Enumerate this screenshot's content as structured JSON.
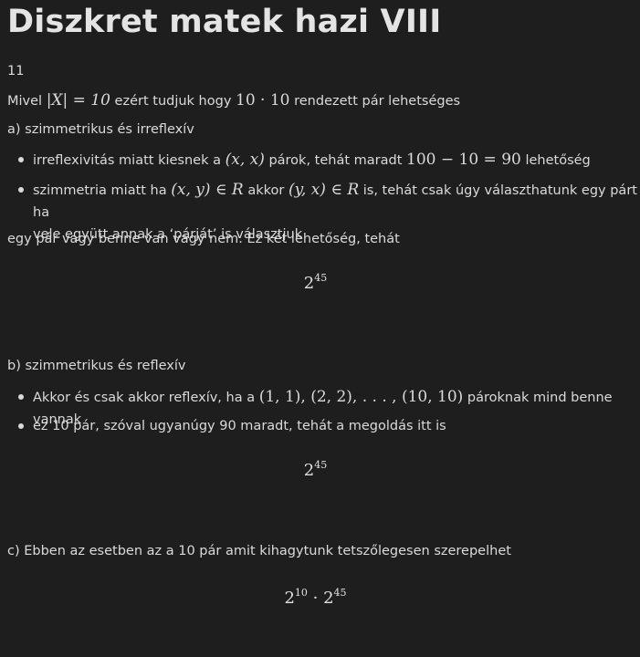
{
  "title": "Diszkret matek hazi VIII",
  "task_number": "11",
  "intro": {
    "pre": "Mivel ",
    "math1": "|X| = 10",
    "mid": " ezért tudjuk hogy ",
    "math2": "10 · 10",
    "post": " rendezett pár lehetséges"
  },
  "part_a": {
    "heading": "a) szimmetrikus és irreflexív",
    "bullet1": {
      "pre": "irreflexivitás miatt kiesnek a ",
      "math1": "(x, x)",
      "mid": " párok, tehát maradt ",
      "math2": "100 − 10 = 90",
      "post": " lehetőség"
    },
    "bullet2": {
      "pre": "szimmetria miatt ha ",
      "math1": "(x, y) ∈ R",
      "mid": " akkor ",
      "math2": "(y, x) ∈ R",
      "post": " is, tehát csak úgy választhatunk egy párt ha",
      "line2": "vele együtt annak a ‘párját’ is választjuk"
    },
    "conclusion": "egy pár vagy benne van vagy nem. Ez két lehetőség, tehát",
    "result": {
      "base": "2",
      "exp": "45"
    }
  },
  "part_b": {
    "heading": "b) szimmetrikus és reflexív",
    "bullet1": {
      "pre": "Akkor és csak akkor reflexív, ha a ",
      "math": "(1, 1), (2, 2), . . . , (10, 10)",
      "post": " pároknak mind benne vannak"
    },
    "bullet2": "ez 10 pár, szóval ugyanúgy 90 maradt, tehát a megoldás itt is",
    "result": {
      "base": "2",
      "exp": "45"
    }
  },
  "part_c": {
    "heading": "c) Ebben az esetben az a 10 pár amit kihagytunk tetszőlegesen szerepelhet",
    "result": {
      "base1": "2",
      "exp1": "10",
      "dot": " · ",
      "base2": "2",
      "exp2": "45"
    }
  }
}
